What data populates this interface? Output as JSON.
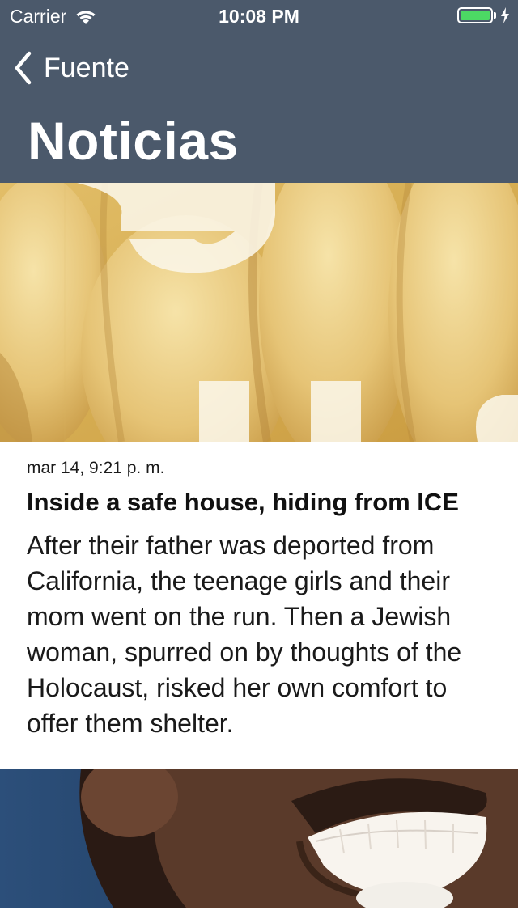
{
  "status_bar": {
    "carrier": "Carrier",
    "time": "10:08 PM",
    "battery_level": 1.0,
    "battery_color": "#4cd964",
    "wifi_icon": "wifi-icon",
    "charging_icon": "charging-bolt-icon"
  },
  "nav": {
    "back_label": "Fuente",
    "back_icon": "chevron-left-icon",
    "title": "Noticias",
    "background_color": "#4b596b"
  },
  "feed": {
    "articles": [
      {
        "date": "mar 14, 9:21 p. m.",
        "title": "Inside a safe house, hiding from ICE",
        "summary": "After their father was deported from California, the teenage girls and their mom went on the run. Then a Jewish woman, spurred on by thoughts of the Holocaust, risked her own comfort to offer them shelter."
      }
    ]
  }
}
